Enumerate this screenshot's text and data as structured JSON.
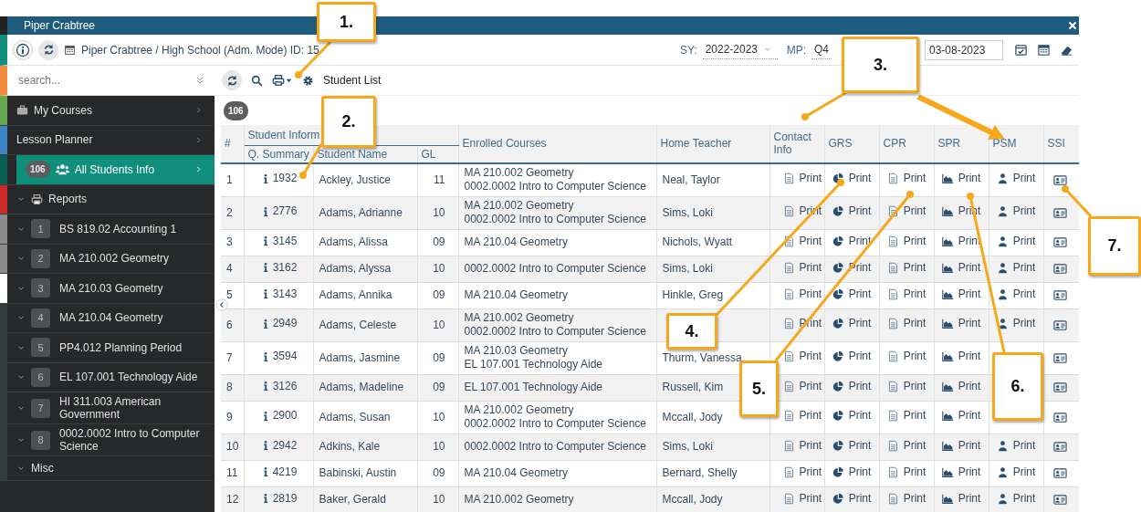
{
  "window": {
    "title": "Piper Crabtree"
  },
  "header": {
    "context": "Piper Crabtree / High School (Adm. Mode) ID: 15",
    "sy_label": "SY:",
    "sy_value": "2022-2023",
    "mp_label": "MP:",
    "mp_value": "Q4",
    "date": "03-08-2023"
  },
  "sidebar": {
    "search_placeholder": "search...",
    "items": [
      {
        "kind": "folder",
        "label": "My Courses",
        "color": "#6aa84f",
        "selected": false
      },
      {
        "kind": "link",
        "label": "Lesson Planner",
        "color": "#3d85c6",
        "selected": false
      },
      {
        "kind": "people",
        "label": "All Students Info",
        "badge": "106",
        "color": "#0b5e52",
        "selected": true
      },
      {
        "kind": "reports",
        "label": "Reports",
        "color": "#cc2929",
        "selected": false
      },
      {
        "kind": "course",
        "badge": "1",
        "label": "BS 819.02 Accounting 1",
        "color": "#8c8c8c",
        "selected": false
      },
      {
        "kind": "course",
        "badge": "2",
        "label": "MA 210.002 Geometry",
        "color": "#8c8c8c",
        "selected": false
      },
      {
        "kind": "course",
        "badge": "3",
        "label": "MA 210.03 Geometry",
        "color": "#ffffff",
        "selected": false
      },
      {
        "kind": "course",
        "badge": "4",
        "label": "MA 210.04 Geometry",
        "color": "#333c3c",
        "selected": false
      },
      {
        "kind": "course",
        "badge": "5",
        "label": "PP4.012 Planning Period",
        "color": "#333c3c",
        "selected": false
      },
      {
        "kind": "course",
        "badge": "6",
        "label": "EL 107.001 Technology Aide",
        "color": "#333c3c",
        "selected": false
      },
      {
        "kind": "course",
        "badge": "7",
        "label": "HI 311.003 American Government",
        "color": "#333c3c",
        "selected": false
      },
      {
        "kind": "course",
        "badge": "8",
        "label": "0002.0002 Intro to Computer Science",
        "color": "#333c3c",
        "selected": false
      },
      {
        "kind": "group",
        "label": "Misc",
        "color": "#333c3c",
        "selected": false
      }
    ]
  },
  "toolbar": {
    "title": "Student List"
  },
  "count": "106",
  "table": {
    "group_heading": "Student Inform",
    "columns": [
      "#",
      "Q. Summary",
      "Student Name",
      "GL",
      "Enrolled Courses",
      "Home Teacher",
      "Contact Info",
      "GRS",
      "CPR",
      "SPR",
      "PSM",
      "SSI"
    ],
    "rows": [
      {
        "num": "1",
        "qs": "1932",
        "name": "Ackley, Justice",
        "gl": "11",
        "courses": [
          "MA 210.002 Geometry",
          "0002.0002 Intro to Computer Science"
        ],
        "teacher": "Neal, Taylor",
        "prints": {
          "contact": "Print",
          "grs": "Print",
          "cpr": "Print",
          "spr": "Print",
          "psm": "Print"
        }
      },
      {
        "num": "2",
        "qs": "2776",
        "name": "Adams, Adrianne",
        "gl": "10",
        "courses": [
          "MA 210.002 Geometry",
          "0002.0002 Intro to Computer Science"
        ],
        "teacher": "Sims, Loki",
        "prints": {
          "contact": "Print",
          "grs": "Print",
          "cpr": "Print",
          "spr": "Print",
          "psm": "Print"
        }
      },
      {
        "num": "3",
        "qs": "3145",
        "name": "Adams, Alissa",
        "gl": "09",
        "courses": [
          "MA 210.04 Geometry"
        ],
        "teacher": "Nichols, Wyatt",
        "prints": {
          "contact": "Print",
          "grs": "Print",
          "cpr": "Print",
          "spr": "Print",
          "psm": "Print"
        }
      },
      {
        "num": "4",
        "qs": "3162",
        "name": "Adams, Alyssa",
        "gl": "10",
        "courses": [
          "0002.0002 Intro to Computer Science"
        ],
        "teacher": "Sims, Loki",
        "prints": {
          "contact": "Print",
          "grs": "Print",
          "cpr": "Print",
          "spr": "Print",
          "psm": "Print"
        }
      },
      {
        "num": "5",
        "qs": "3143",
        "name": "Adams, Annika",
        "gl": "09",
        "courses": [
          "MA 210.04 Geometry"
        ],
        "teacher": "Hinkle, Greg",
        "prints": {
          "contact": "Print",
          "grs": "Print",
          "cpr": "Print",
          "spr": "Print",
          "psm": "Print"
        }
      },
      {
        "num": "6",
        "qs": "2949",
        "name": "Adams, Celeste",
        "gl": "10",
        "courses": [
          "MA 210.002 Geometry",
          "0002.0002 Intro to Computer Science"
        ],
        "prints": {
          "contact": "Print",
          "grs": "Print",
          "cpr": "Print",
          "spr": "Print",
          "psm": "Print"
        }
      },
      {
        "num": "7",
        "qs": "3594",
        "name": "Adams, Jasmine",
        "gl": "09",
        "courses": [
          "MA 210.03 Geometry",
          "EL 107.001 Technology Aide"
        ],
        "teacher": "Thurm, Vanessa",
        "prints": {
          "contact": "Print",
          "grs": "Print",
          "cpr": "Print",
          "spr": "Print"
        }
      },
      {
        "num": "8",
        "qs": "3126",
        "name": "Adams, Madeline",
        "gl": "09",
        "courses": [
          "EL 107.001 Technology Aide"
        ],
        "teacher": "Russell, Kim",
        "prints": {
          "contact": "Print",
          "grs": "Print",
          "cpr": "Print",
          "spr": "Print"
        }
      },
      {
        "num": "9",
        "qs": "2900",
        "name": "Adams, Susan",
        "gl": "10",
        "courses": [
          "MA 210.002 Geometry",
          "0002.0002 Intro to Computer Science"
        ],
        "teacher": "Mccall, Jody",
        "prints": {
          "contact": "Print",
          "grs": "Print",
          "cpr": "Print",
          "spr": "Print"
        }
      },
      {
        "num": "10",
        "qs": "2942",
        "name": "Adkins, Kale",
        "gl": "10",
        "courses": [
          "0002.0002 Intro to Computer Science"
        ],
        "teacher": "Sims, Loki",
        "prints": {
          "contact": "Print",
          "grs": "Print",
          "cpr": "Print",
          "spr": "Print",
          "psm": "Print"
        }
      },
      {
        "num": "11",
        "qs": "4219",
        "name": "Babinski, Austin",
        "gl": "09",
        "courses": [
          "MA 210.04 Geometry"
        ],
        "teacher": "Bernard, Shelly",
        "prints": {
          "contact": "Print",
          "grs": "Print",
          "cpr": "Print",
          "spr": "Print",
          "psm": "Print"
        }
      },
      {
        "num": "12",
        "qs": "2819",
        "name": "Baker, Gerald",
        "gl": "10",
        "courses": [
          "MA 210.002 Geometry"
        ],
        "teacher": "Mccall, Jody",
        "prints": {
          "contact": "Print",
          "grs": "Print",
          "cpr": "Print",
          "spr": "Print",
          "psm": "Print"
        }
      }
    ]
  },
  "callouts": [
    "1.",
    "2.",
    "3.",
    "4.",
    "5.",
    "6.",
    "7."
  ]
}
